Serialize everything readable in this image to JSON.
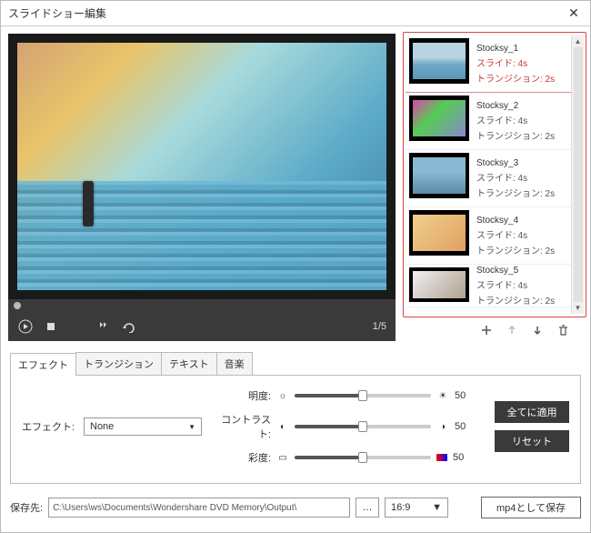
{
  "window": {
    "title": "スライドショー編集"
  },
  "preview": {
    "counter": "1/5"
  },
  "slides": [
    {
      "name": "Stocksy_1",
      "slide": "スライド: 4s",
      "transition": "トランジション: 2s"
    },
    {
      "name": "Stocksy_2",
      "slide": "スライド: 4s",
      "transition": "トランジション: 2s"
    },
    {
      "name": "Stocksy_3",
      "slide": "スライド: 4s",
      "transition": "トランジション: 2s"
    },
    {
      "name": "Stocksy_4",
      "slide": "スライド: 4s",
      "transition": "トランジション: 2s"
    },
    {
      "name": "Stocksy_5",
      "slide": "スライド: 4s",
      "transition": "トランジション: 2s"
    }
  ],
  "tabs": {
    "effect": "エフェクト",
    "transition": "トランジション",
    "text": "テキスト",
    "music": "音楽"
  },
  "effect": {
    "label": "エフェクト:",
    "value": "None",
    "brightness_label": "明度:",
    "contrast_label": "コントラスト:",
    "saturation_label": "彩度:",
    "brightness_value": "50",
    "contrast_value": "50",
    "saturation_value": "50",
    "apply_all": "全てに適用",
    "reset": "リセット"
  },
  "bottom": {
    "dest_label": "保存先:",
    "path": "C:\\Users\\ws\\Documents\\Wondershare DVD Memory\\Output\\",
    "dots": "…",
    "ratio": "16:9",
    "save": "mp4として保存"
  }
}
